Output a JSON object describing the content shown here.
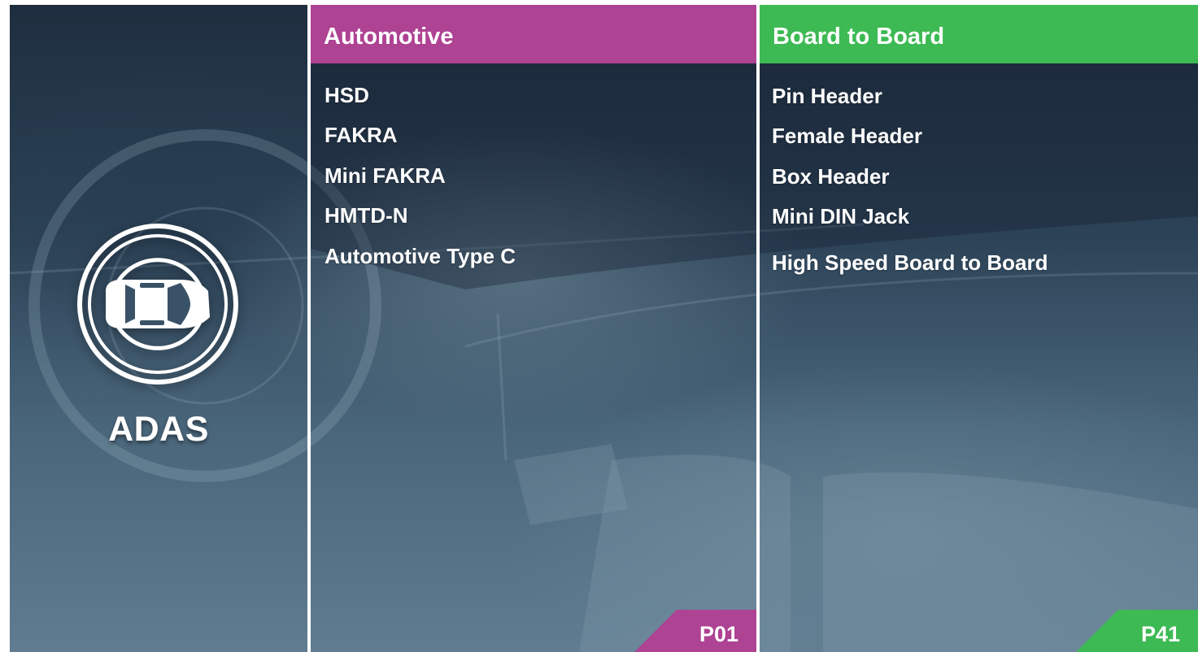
{
  "colors": {
    "automotive_accent": "#ae4293",
    "board_accent": "#3dba53",
    "divider": "#ffffff"
  },
  "left_panel": {
    "icon": "car-sensor-icon",
    "title": "ADAS"
  },
  "columns": [
    {
      "header": "Automotive",
      "items": [
        "HSD",
        "FAKRA",
        "Mini FAKRA",
        "HMTD-N",
        "Automotive Type C"
      ],
      "page_tag": "P01"
    },
    {
      "header": "Board to Board",
      "items": [
        "Pin Header",
        "Female Header",
        "Box Header",
        "Mini DIN Jack",
        "High Speed Board to Board"
      ],
      "page_tag": "P41"
    }
  ]
}
